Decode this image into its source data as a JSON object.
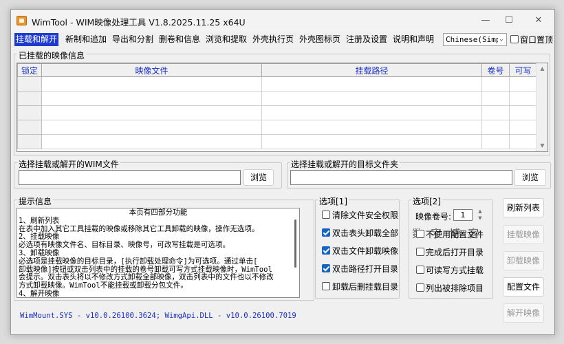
{
  "window": {
    "title": "WimTool - WIM映像处理工具 V1.8.2025.11.25 x64U",
    "minimize": "—",
    "maximize": "☐",
    "close": "✕"
  },
  "tabs": [
    {
      "label": "挂载和解开",
      "active": true
    },
    {
      "label": "新制和追加"
    },
    {
      "label": "导出和分割"
    },
    {
      "label": "删卷和信息"
    },
    {
      "label": "浏览和提取"
    },
    {
      "label": "外壳执行页"
    },
    {
      "label": "外壳图标页"
    },
    {
      "label": "注册及设置"
    },
    {
      "label": "说明和声明"
    }
  ],
  "language": {
    "value": "Chinese(Simp"
  },
  "topmost": {
    "label": "窗口置顶",
    "checked": false
  },
  "mounted": {
    "title": "已挂载的映像信息",
    "columns": [
      "锁定",
      "映像文件",
      "挂载路径",
      "卷号",
      "可写"
    ]
  },
  "wim_file": {
    "title": "选择挂载或解开的WIM文件",
    "value": "",
    "browse": "浏览"
  },
  "target_folder": {
    "title": "选择挂载或解开的目标文件夹",
    "value": "",
    "browse": "浏览"
  },
  "info": {
    "title": "提示信息",
    "head": "本页有四部分功能",
    "lines": [
      "1、刷新列表",
      "  在表中加入其它工具挂载的映像或移除其它工具卸载的映像，操作无选项。",
      "2、挂载映像",
      "  必选项有映像文件名、目标目录、映像号，可改写挂载是可选项。",
      "3、卸载映像",
      "  必选项是挂载映像的目标目录，[执行卸载处理命令]为可选项。通过单击[",
      "卸载映像]按钮或双击列表中的挂载的卷号卸载可写方式挂载映像时，WimTool",
      "会提示。双击表头将以不修改方式卸载全部映像，双击列表中的文件也以不修改",
      "方式卸载映像。WimTool不能挂载或卸载分包文件。",
      "4、解开映像"
    ]
  },
  "options1": {
    "title": "选项[1]",
    "items": [
      {
        "label": "清除文件安全权限",
        "checked": false
      },
      {
        "label": "双击表头卸载全部",
        "checked": true
      },
      {
        "label": "双击文件卸载映像",
        "checked": true
      },
      {
        "label": "双击路径打开目录",
        "checked": true
      },
      {
        "label": "卸载后删挂载目录",
        "checked": false
      }
    ]
  },
  "options2": {
    "title": "选项[2]",
    "volume_label": "映像卷号:",
    "volume_value": "1",
    "items": [
      {
        "label": "不使用配置文件",
        "checked": false
      },
      {
        "label": "完成后打开目录",
        "checked": false
      },
      {
        "label": "可读写方式挂载",
        "checked": false
      },
      {
        "label": "列出被排除项目",
        "checked": false
      }
    ]
  },
  "watermark": "数 字 博 客",
  "actions": [
    {
      "label": "刷新列表",
      "enabled": true
    },
    {
      "label": "挂载映像",
      "enabled": false
    },
    {
      "label": "卸载映像",
      "enabled": false
    },
    {
      "label": "配置文件",
      "enabled": true
    },
    {
      "label": "解开映像",
      "enabled": false
    }
  ],
  "status": "WimMount.SYS - v10.0.26100.3624; WimgApi.DLL - v10.0.26100.7019",
  "colors": {
    "accent": "#1e3bd0",
    "header_text": "#1a2fc2",
    "checkbox": "#1565c0"
  }
}
